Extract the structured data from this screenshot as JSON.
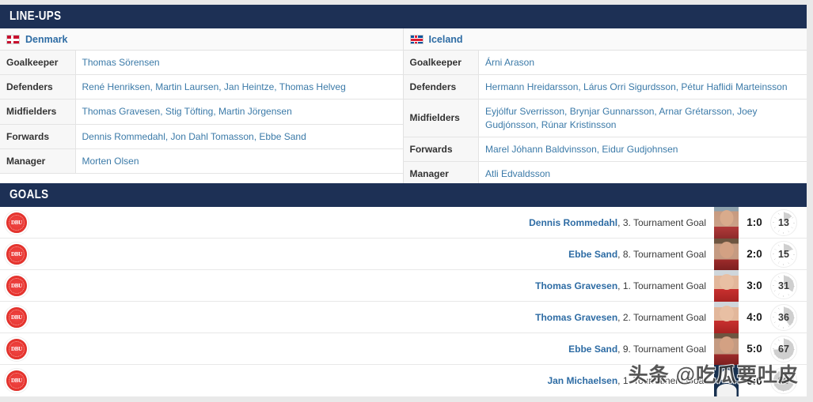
{
  "colors": {
    "header_bar": "#1d3055",
    "link": "#2e6ca4",
    "page_background": "#e9e9e9",
    "panel_background": "#ffffff",
    "role_cell_background": "#f7f7f7",
    "crest_red": "#e8352f"
  },
  "lineups": {
    "section_title": "LINE-UPS",
    "teams": [
      {
        "name": "Denmark",
        "flag": "flag-denmark-icon",
        "rows": [
          {
            "role": "Goalkeeper",
            "players": "Thomas Sörensen"
          },
          {
            "role": "Defenders",
            "players": "René Henriksen, Martin Laursen, Jan Heintze, Thomas Helveg"
          },
          {
            "role": "Midfielders",
            "players": "Thomas Gravesen, Stig Töfting, Martin Jörgensen"
          },
          {
            "role": "Forwards",
            "players": "Dennis Rommedahl, Jon Dahl Tomasson, Ebbe Sand"
          },
          {
            "role": "Manager",
            "players": "Morten Olsen"
          }
        ]
      },
      {
        "name": "Iceland",
        "flag": "flag-iceland-icon",
        "rows": [
          {
            "role": "Goalkeeper",
            "players": "Árni Arason"
          },
          {
            "role": "Defenders",
            "players": "Hermann Hreidarsson, Lárus Orri Sigurdsson, Pétur Haflidi Marteinsson"
          },
          {
            "role": "Midfielders",
            "players": "Eyjólfur Sverrisson, Brynjar Gunnarsson, Arnar Grétarsson, Joey Gudjónsson, Rúnar Kristinsson"
          },
          {
            "role": "Forwards",
            "players": "Marel Jóhann Baldvinsson, Eidur Gudjohnsen"
          },
          {
            "role": "Manager",
            "players": "Atli Edvaldsson"
          }
        ]
      }
    ]
  },
  "goals": {
    "section_title": "GOALS",
    "crest_label": "DBU",
    "rows": [
      {
        "player": "Dennis Rommedahl",
        "note": ", 3. Tournament Goal",
        "score": "1:0",
        "minute": "13",
        "photo": "ph-a"
      },
      {
        "player": "Ebbe Sand",
        "note": ", 8. Tournament Goal",
        "score": "2:0",
        "minute": "15",
        "photo": "ph-b"
      },
      {
        "player": "Thomas Gravesen",
        "note": ", 1. Tournament Goal",
        "score": "3:0",
        "minute": "31",
        "photo": "ph-c"
      },
      {
        "player": "Thomas Gravesen",
        "note": ", 2. Tournament Goal",
        "score": "4:0",
        "minute": "36",
        "photo": "ph-c"
      },
      {
        "player": "Ebbe Sand",
        "note": ", 9. Tournament Goal",
        "score": "5:0",
        "minute": "67",
        "photo": "ph-b"
      },
      {
        "player": "Jan Michaelsen",
        "note": ", 1. Tournament Goal",
        "score": "6:0",
        "minute": "90",
        "photo": "ph-sil"
      }
    ]
  },
  "watermark": {
    "text": "头条 @吃瓜要吐皮"
  }
}
